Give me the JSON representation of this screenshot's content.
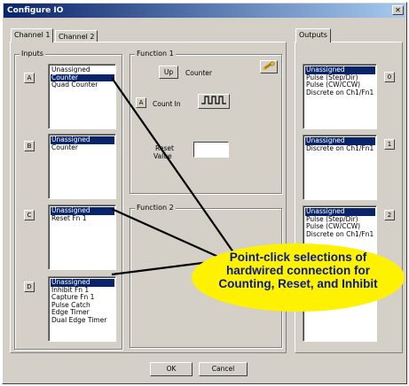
{
  "window": {
    "title": "Configure IO",
    "close_glyph": "✕"
  },
  "tabs": [
    {
      "label": "Channel 1"
    },
    {
      "label": "Channel 2"
    }
  ],
  "outputs_tab": {
    "label": "Outputs"
  },
  "inputs": {
    "group_label": "Inputs",
    "rows": [
      {
        "letter": "A",
        "items": [
          "Unassigned",
          "Counter",
          "Quad Counter"
        ],
        "selected": 1
      },
      {
        "letter": "B",
        "items": [
          "Unassigned",
          "Counter"
        ],
        "selected": 0
      },
      {
        "letter": "C",
        "items": [
          "Unassigned",
          "Reset Fn 1"
        ],
        "selected": 0
      },
      {
        "letter": "D",
        "items": [
          "Unassigned",
          "Inhibit Fn 1",
          "Capture Fn 1",
          "Pulse Catch",
          "Edge Timer",
          "Dual Edge Timer"
        ],
        "selected": 0
      }
    ]
  },
  "function1": {
    "group_label": "Function 1",
    "up_button": "Up",
    "counter_label": "Counter",
    "letter": "A",
    "count_in_label": "Count In",
    "reset_label_line1": "Reset",
    "reset_label_line2": "Value",
    "reset_value": ""
  },
  "function2": {
    "group_label": "Function 2"
  },
  "outputs": {
    "rows": [
      {
        "number": "0",
        "items": [
          "Unassigned",
          "Pulse (Step/Dir)",
          "Pulse (CW/CCW)",
          "Discrete on Ch1/Fn1"
        ],
        "selected": 0
      },
      {
        "number": "1",
        "items": [
          "Unassigned",
          "Discrete on Ch1/Fn1"
        ],
        "selected": 0
      },
      {
        "number": "2",
        "items": [
          "Unassigned",
          "Pulse (Step/Dir)",
          "Pulse (CW/CCW)",
          "Discrete on Ch1/Fn1"
        ],
        "selected": 0
      }
    ]
  },
  "buttons": {
    "ok": "OK",
    "cancel": "Cancel"
  },
  "callout": {
    "line1": "Point-click selections of",
    "line2": "hardwired connection for",
    "line3": "Counting, Reset, and Inhibit"
  },
  "colors": {
    "selection": "#0a246a",
    "callout_fill": "#fff200",
    "callout_text": "#0a1a8c",
    "dialog_face": "#d4d0c8"
  },
  "icons": {
    "wrench": "wrench-icon",
    "pulse": "square-wave-icon"
  }
}
